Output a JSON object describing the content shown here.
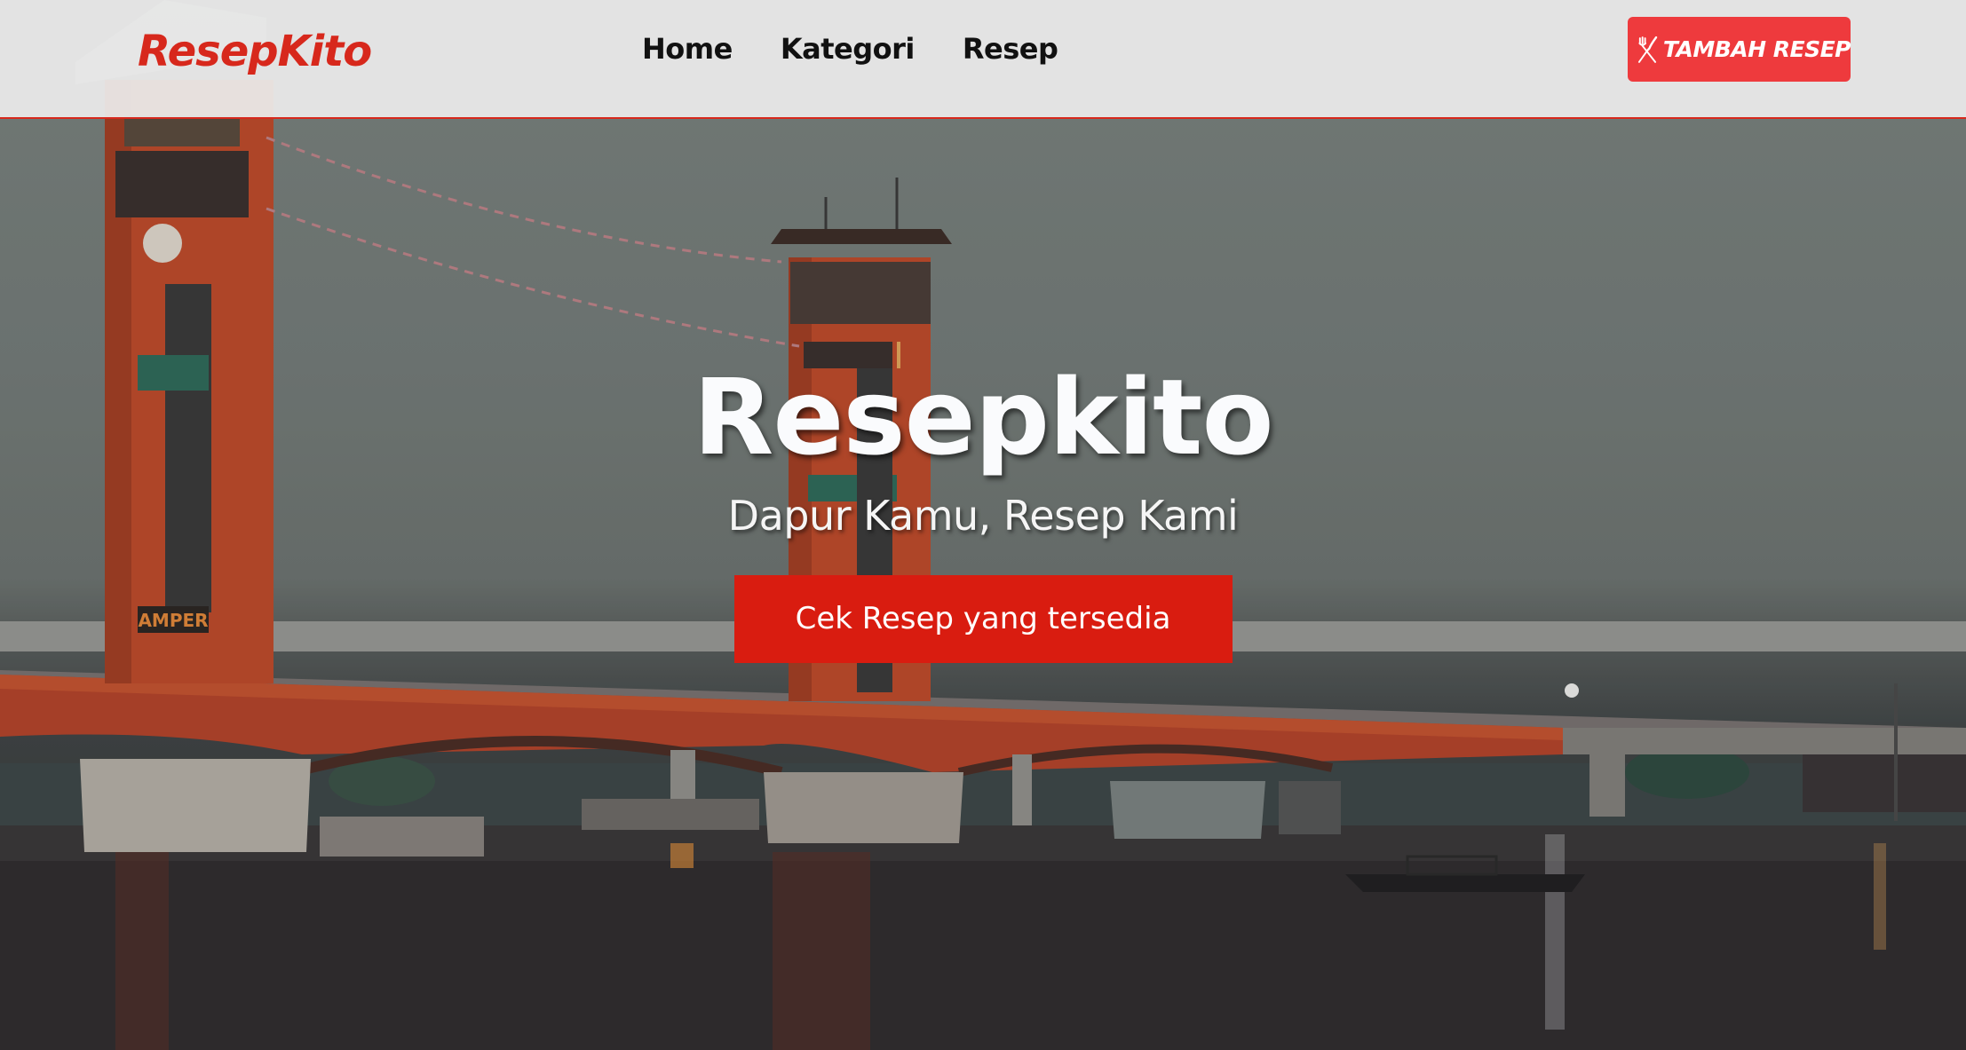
{
  "navbar": {
    "brand": "ResepKito",
    "links": [
      "Home",
      "Kategori",
      "Resep"
    ],
    "add_recipe_label": "TAMBAH RESEP",
    "add_recipe_icon": "fork-knife-icon"
  },
  "hero": {
    "title": "Resepkito",
    "subtitle": "Dapur Kamu, Resep Kami",
    "cta_label": "Cek Resep yang tersedia",
    "background": "photo-ampera-bridge-river-dusk",
    "bridge_sign_text": "AMPER"
  },
  "colors": {
    "brand_red": "#d7281c",
    "cta_red": "#d91c10",
    "add_button_red": "#ee3a3d",
    "navbar_bg": "#ececec",
    "bridge_orange": "#c24a2a"
  }
}
